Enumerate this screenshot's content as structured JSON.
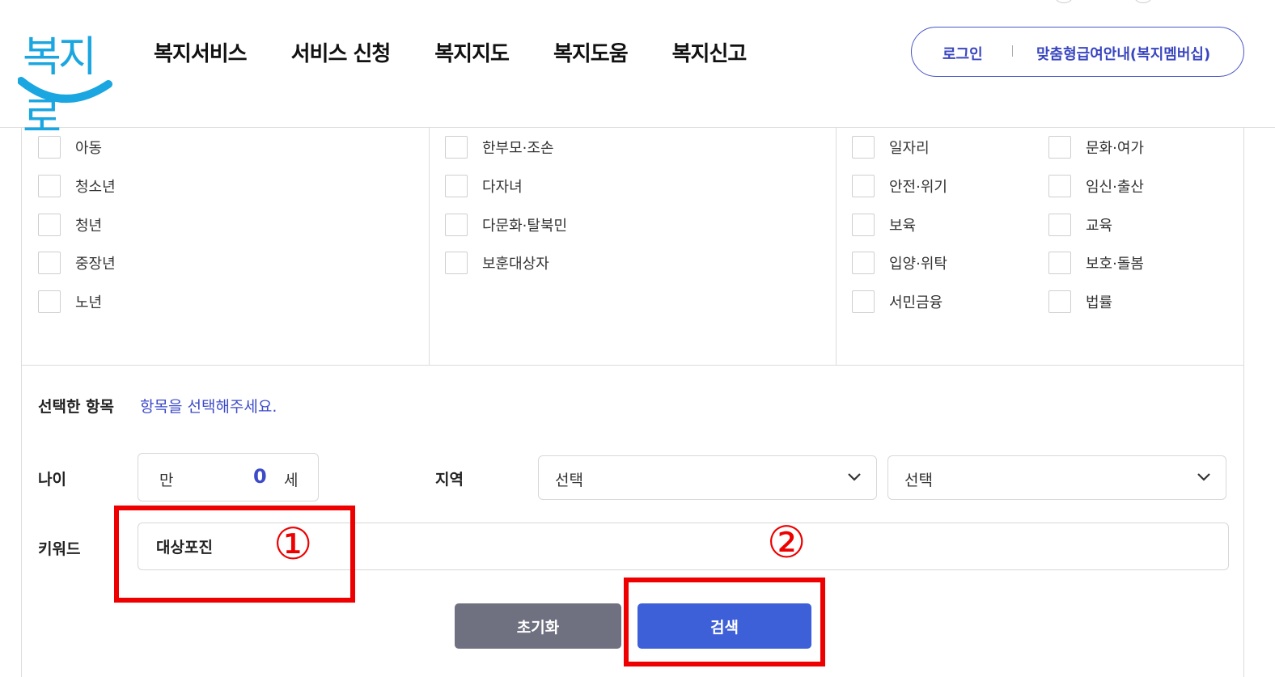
{
  "header": {
    "logo_text": "복지로",
    "nav": [
      "복지서비스",
      "서비스 신청",
      "복지지도",
      "복지도움",
      "복지신고"
    ],
    "login": "로그인",
    "membership": "맞춤형급여안내(복지멤버십)"
  },
  "categories": {
    "col1": [
      "아동",
      "청소년",
      "청년",
      "중장년",
      "노년"
    ],
    "col2": [
      "한부모·조손",
      "다자녀",
      "다문화·탈북민",
      "보훈대상자"
    ],
    "col3": [
      "일자리",
      "안전·위기",
      "보육",
      "입양·위탁",
      "서민금융"
    ],
    "col4": [
      "문화·여가",
      "임신·출산",
      "교육",
      "보호·돌봄",
      "법률"
    ]
  },
  "selected": {
    "label": "선택한 항목",
    "hint": "항목을 선택해주세요."
  },
  "age": {
    "label": "나이",
    "prefix": "만",
    "value": "0",
    "suffix": "세"
  },
  "region": {
    "label": "지역",
    "select1": "선택",
    "select2": "선택"
  },
  "keyword": {
    "label": "키워드",
    "value": "대상포진"
  },
  "buttons": {
    "reset": "초기화",
    "search": "검색"
  },
  "annotations": {
    "marker1": "①",
    "marker2": "②",
    "color": "#ee0000"
  }
}
